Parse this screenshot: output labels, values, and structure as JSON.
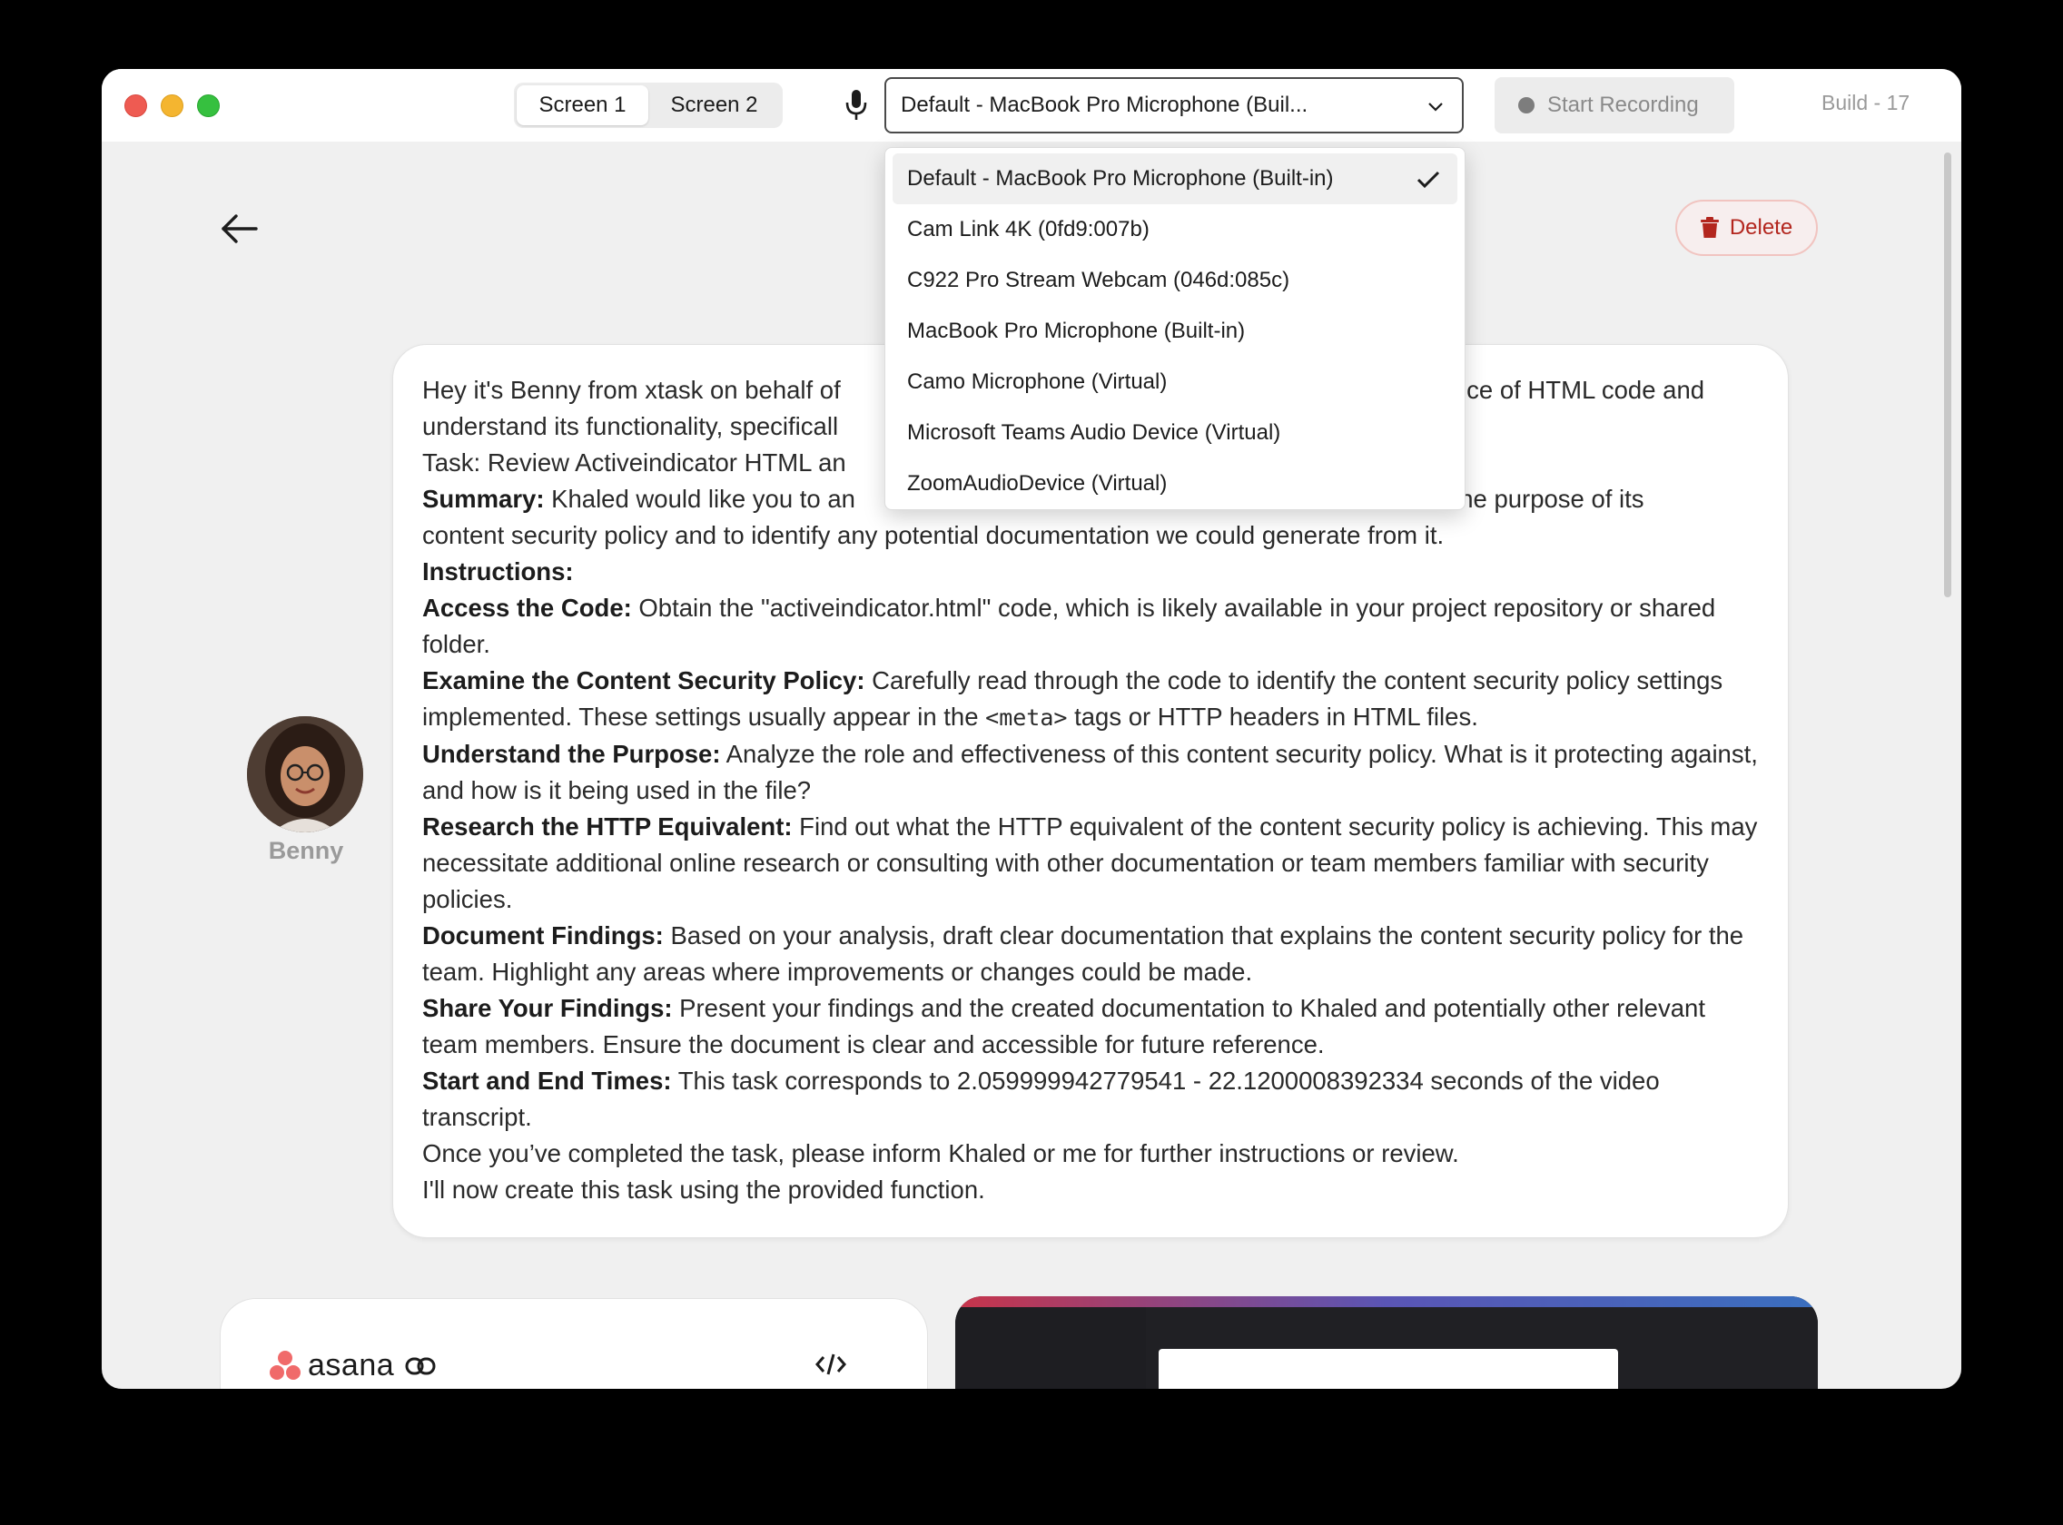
{
  "toolbar": {
    "screen_tabs": [
      "Screen 1",
      "Screen 2"
    ],
    "mic_selected": "Default - MacBook Pro Microphone (Buil...",
    "record_label": "Start Recording",
    "build_label": "Build - 17"
  },
  "dropdown": {
    "options": [
      "Default - MacBook Pro Microphone (Built-in)",
      "Cam Link 4K (0fd9:007b)",
      "C922 Pro Stream Webcam (046d:085c)",
      "MacBook Pro Microphone (Built-in)",
      "Camo Microphone (Virtual)",
      "Microsoft Teams Audio Device (Virtual)",
      "ZoomAudioDevice (Virtual)"
    ]
  },
  "header": {
    "delete_label": "Delete"
  },
  "sender": {
    "name": "Benny"
  },
  "message": {
    "line1": "Hey it's Benny from xtask on behalf of",
    "line1_right": "iece of HTML code and",
    "line2": "understand its functionality, specificall",
    "line3": "Task: Review Activeindicator HTML an",
    "summary_label": "Summary:",
    "summary_text_a": " Khaled would like you to an",
    "summary_text_b": " the purpose of its",
    "summary_text_c": "content security policy and to identify any potential documentation we could generate from it.",
    "instructions_label": "Instructions:",
    "access_label": "Access the Code:",
    "access_text": " Obtain the \"activeindicator.html\" code, which is likely available in your project repository or shared folder.",
    "examine_label": "Examine the Content Security Policy:",
    "examine_text_a": " Carefully read through the code to identify the content security policy settings implemented. These settings usually appear in the ",
    "examine_code": "<meta>",
    "examine_text_b": " tags or HTTP headers in HTML files.",
    "purpose_label": "Understand the Purpose:",
    "purpose_text": " Analyze the role and effectiveness of this content security policy. What is it protecting against, and how is it being used in the file?",
    "http_label": "Research the HTTP Equivalent:",
    "http_text": " Find out what the HTTP equivalent of the content security policy is achieving. This may necessitate additional online research or consulting with other documentation or team members familiar with security policies.",
    "doc_label": "Document Findings:",
    "doc_text": " Based on your analysis, draft clear documentation that explains the content security policy for the team. Highlight any areas where improvements or changes could be made.",
    "share_label": "Share Your Findings:",
    "share_text": " Present your findings and the created documentation to Khaled and potentially other relevant team members. Ensure the document is clear and accessible for future reference.",
    "times_label": "Start and End Times:",
    "times_text": " This task corresponds to 2.059999942779541 - 22.1200008392334 seconds of the video transcript.",
    "closing1": "Once you’ve completed the task, please inform Khaled or me for further instructions or review.",
    "closing2": "I'll now create this task using the provided function."
  },
  "integration_card": {
    "brand": "asana"
  }
}
